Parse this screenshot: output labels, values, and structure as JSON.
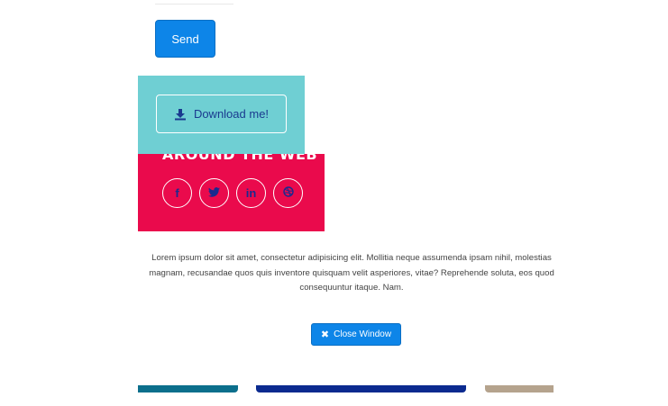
{
  "form": {
    "send_label": "Send"
  },
  "download": {
    "label": "Download me!"
  },
  "social": {
    "heading": "AROUND THE WEB",
    "items": [
      {
        "icon": "facebook-icon",
        "glyph": "f"
      },
      {
        "icon": "twitter-icon",
        "glyph": "t"
      },
      {
        "icon": "linkedin-icon",
        "glyph": "in"
      },
      {
        "icon": "dribbble-icon",
        "glyph": "◎"
      }
    ]
  },
  "body": {
    "text": "Lorem ipsum dolor sit amet, consectetur adipisicing elit. Mollitia neque assumenda ipsam nihil, molestias magnam, recusandae quos quis inventore quisquam velit asperiores, vitae? Reprehende soluta, eos quod consequuntur itaque. Nam."
  },
  "modal": {
    "close_label": "Close Window"
  },
  "colors": {
    "primary": "#0d85e8",
    "teal": "#6fcfd3",
    "red": "#ea0a4c",
    "navy": "#1a2a8f"
  }
}
